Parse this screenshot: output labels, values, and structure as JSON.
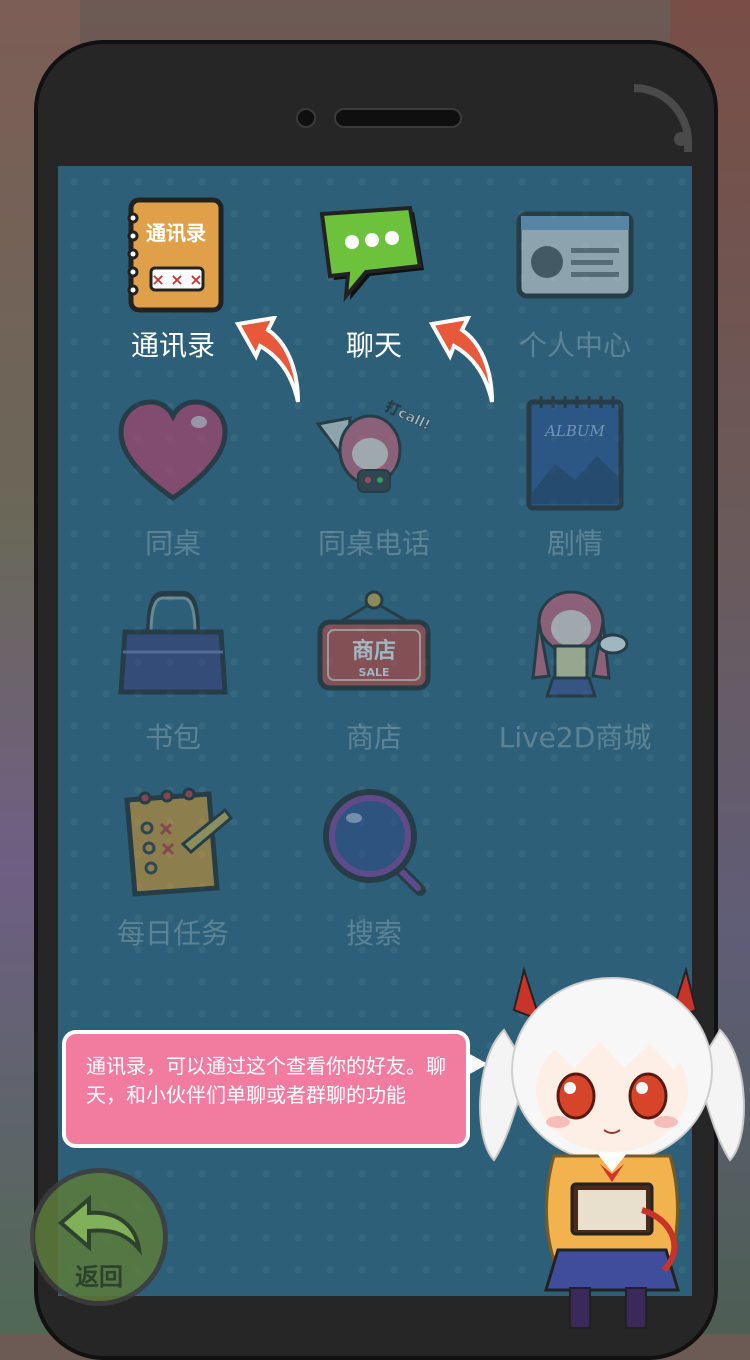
{
  "apps": [
    {
      "id": "contacts",
      "label": "通讯录",
      "active": true,
      "icon": "contacts-book-icon",
      "badge_text": "通讯录"
    },
    {
      "id": "chat",
      "label": "聊天",
      "active": true,
      "icon": "chat-bubble-icon"
    },
    {
      "id": "profile",
      "label": "个人中心",
      "active": false,
      "icon": "id-card-icon"
    },
    {
      "id": "deskmate",
      "label": "同桌",
      "active": false,
      "icon": "heart-icon"
    },
    {
      "id": "deskmate_call",
      "label": "同桌电话",
      "active": false,
      "icon": "call-girl-icon",
      "badge_text": "打call!"
    },
    {
      "id": "story",
      "label": "剧情",
      "active": false,
      "icon": "album-icon",
      "badge_text": "ALBUM"
    },
    {
      "id": "bag",
      "label": "书包",
      "active": false,
      "icon": "school-bag-icon"
    },
    {
      "id": "shop",
      "label": "商店",
      "active": false,
      "icon": "shop-sign-icon",
      "badge_text": "商店",
      "badge_sub": "SALE"
    },
    {
      "id": "live2d",
      "label": "Live2D商城",
      "active": false,
      "icon": "live2d-girl-icon"
    },
    {
      "id": "daily",
      "label": "每日任务",
      "active": false,
      "icon": "task-list-icon"
    },
    {
      "id": "search",
      "label": "搜索",
      "active": false,
      "icon": "magnifier-icon"
    }
  ],
  "tutorial": {
    "text": "通讯录，可以通过这个查看你的好友。聊天，和小伙伴们单聊或者群聊的功能"
  },
  "back_button": {
    "label": "返回"
  },
  "colors": {
    "screen": "#2d6078",
    "bubble": "#f27c9f",
    "arrow": "#e8593c"
  }
}
